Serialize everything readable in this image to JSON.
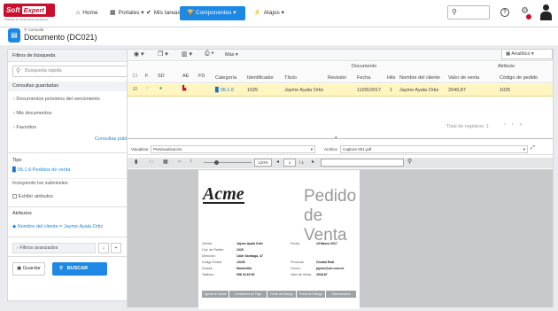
{
  "app": {
    "logo_main": "Soft",
    "logo_box": "Expert",
    "logo_sub": "Software for Performance Excellence"
  },
  "nav": {
    "home": "Home",
    "portals": "Portales",
    "tasks": "Mis tareas",
    "components": "Componentes",
    "shortcuts": "Atajos"
  },
  "header": {
    "breadcrumb": "Consulta",
    "title": "Documento (DC021)"
  },
  "sidebar": {
    "filters_title": "Filtros de búsqueda",
    "collapse": "«",
    "quick_search_placeholder": "Búsqueda rápida",
    "saved_title": "Consultas guardadas",
    "saved_items": [
      "Documentos próximos del vencimiento",
      "Mis documentos",
      "Favoritos"
    ],
    "public_link": "Consultas públicas",
    "type_title": "Tipo",
    "type_value": "05.1.6-Pedidos de venta",
    "include_sub": "Incluyendo los subniveles",
    "show_attrs": "Exhibir atributos",
    "attrs_title": "Atributos",
    "attr_filter": "Nombre del cliente = Jayme Ayala Ortiz",
    "adv_filters": "Filtros avanzados",
    "save_btn": "Guardar",
    "search_btn": "BUSCAR"
  },
  "toolbar": {
    "more": "Más",
    "view": "Analítico"
  },
  "grid": {
    "group_doc": "Documento",
    "group_attr": "Atributo",
    "cols": [
      "F",
      "SD",
      "AE",
      "FD",
      "Categoría",
      "Identificador",
      "Título",
      "Revisión",
      "Fecha",
      "Hits",
      "Nombre del cliente",
      "Valor de venta",
      "Código de pedido"
    ],
    "row": {
      "category": "05.1.6",
      "id": "1025",
      "title": "Jayme Ayala Ortiz",
      "revision": "",
      "date": "11/05/2017",
      "hits": "1",
      "client": "Jayme Ayala Ortiz",
      "value": "2949,87",
      "code": "1025"
    },
    "total": "Total de registros: 1"
  },
  "viewer": {
    "view_label": "Visualizar",
    "view_value": "Previsualización",
    "file_label": "Archivo",
    "file_value": "Capture 001.pdf",
    "zoom": "120%",
    "page": "1",
    "pages": "/ 1"
  },
  "doc": {
    "brand": "Acme",
    "title": "Pedido de Venta",
    "labels": [
      "Cliente:",
      "Cód. de Pedido:",
      "Dirección:",
      "Código Postal:",
      "Ciudad:",
      "Teléfono:"
    ],
    "values": [
      "Jayme Ayala Ortiz",
      "1025",
      "Calle Santiago, 47",
      "13230",
      "Montevilla",
      "998 34 63 50"
    ],
    "labels2": [
      "Fecha:",
      "",
      "",
      "Provincia:",
      "Correo:",
      "Valor de Venta:"
    ],
    "values2": [
      "15 Marzo 2017",
      "",
      "",
      "Ciudad Real",
      "jayme@sol.com.es",
      "2949,87"
    ],
    "footer": [
      "Agente de Ventas",
      "Condiciones de Pago",
      "Fecha de Entrega",
      "Forma de Entrega",
      "Observaciones"
    ]
  }
}
